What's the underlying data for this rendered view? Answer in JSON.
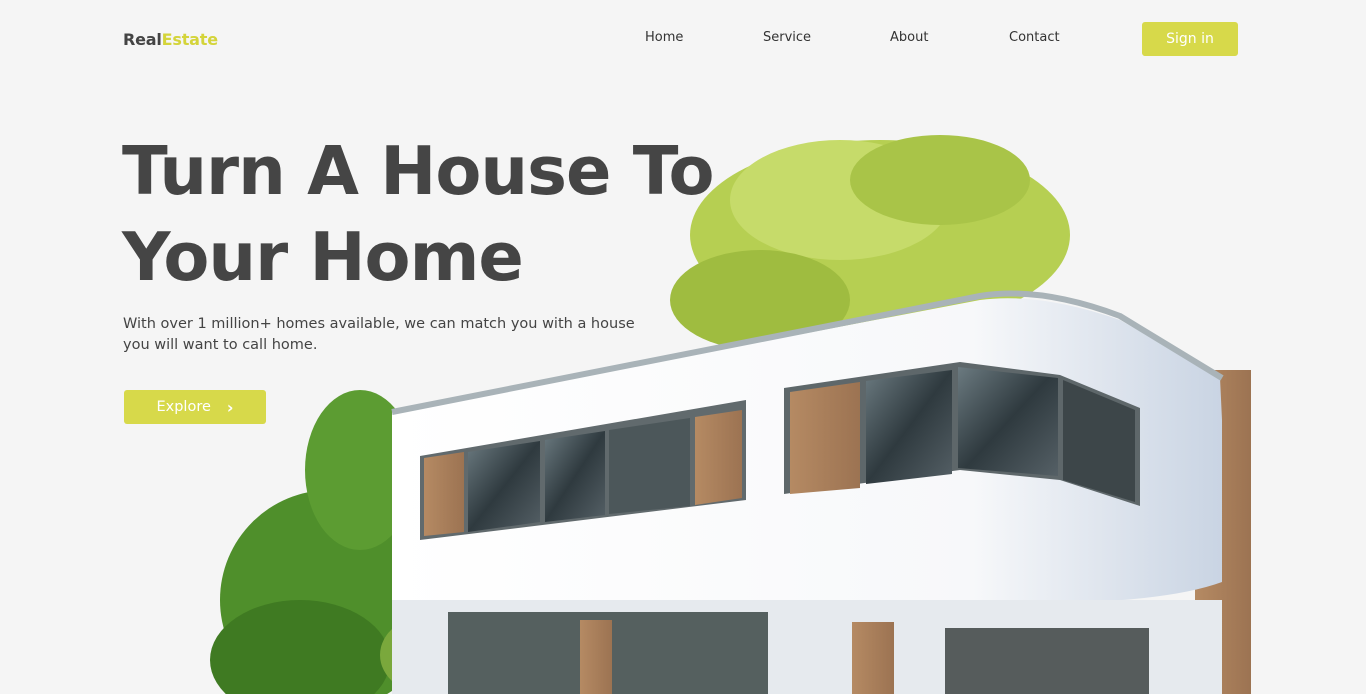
{
  "logo": {
    "part1": "Real",
    "part2": "Estate"
  },
  "nav": {
    "items": [
      {
        "label": "Home"
      },
      {
        "label": "Service"
      },
      {
        "label": "About"
      },
      {
        "label": "Contact"
      }
    ],
    "signin_label": "Sign in"
  },
  "hero": {
    "title_line1": "Turn A House To",
    "title_line2": "Your Home",
    "subtitle": "With over 1 million+ homes available, we can match you with a house you will want to call home.",
    "explore_label": "Explore",
    "explore_icon": "chevron-right-icon"
  },
  "colors": {
    "accent": "#d7d94a",
    "text_dark": "#454545",
    "background": "#f5f5f5"
  },
  "illustration": {
    "name": "modern-house-image"
  }
}
